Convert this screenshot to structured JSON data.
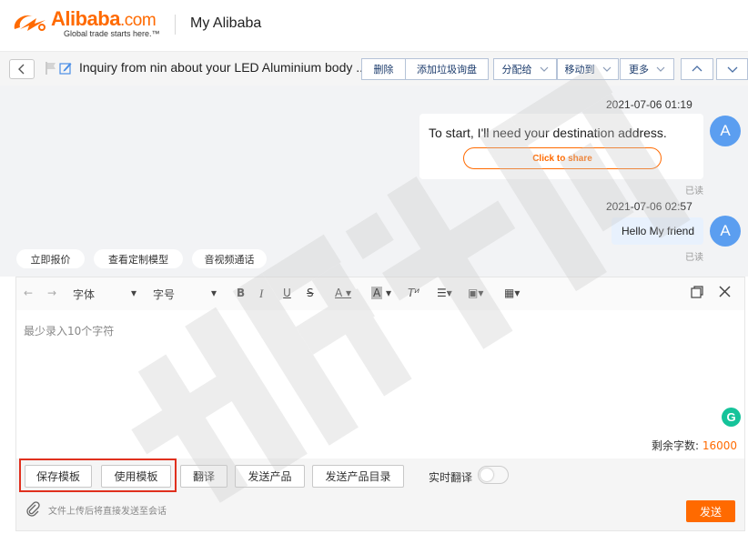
{
  "header": {
    "logo_text": "Alibaba",
    "logo_com": ".com",
    "logo_tagline": "Global trade starts here.™",
    "title": "My Alibaba"
  },
  "toolbar": {
    "back_icon": "chevron-left-icon",
    "subject": "Inquiry from nin about your LED Aluminium body ...",
    "buttons": {
      "delete": "删除",
      "add_spam": "添加垃圾询盘",
      "assign": "分配给",
      "move": "移动到",
      "more": "更多"
    }
  },
  "chat": {
    "messages": [
      {
        "time": "2021-07-06 01:19",
        "text": "To start, I'll need your destination address.",
        "action": "Click to share",
        "avatar": "A",
        "status": "已读"
      },
      {
        "time": "2021-07-06 02:57",
        "text": "Hello My friend",
        "avatar": "A",
        "status": "已读"
      }
    ],
    "quick_actions": [
      "立即报价",
      "查看定制模型",
      "音视频通话"
    ]
  },
  "editor": {
    "font_label": "字体",
    "size_label": "字号",
    "placeholder": "最少录入10个字符",
    "remaining_label": "剩余字数:",
    "remaining_count": "16000",
    "bottom_buttons": [
      "保存模板",
      "使用模板",
      "翻译",
      "发送产品",
      "发送产品目录"
    ],
    "realtime_label": "实时翻译",
    "realtime_on": false,
    "attach_hint": "文件上传后将直接发送至会话",
    "send_label": "发送"
  },
  "colors": {
    "accent": "#ff6a00",
    "avatar": "#5b9ef0",
    "highlight_box": "#e0301e",
    "grammarly": "#15c39a"
  }
}
